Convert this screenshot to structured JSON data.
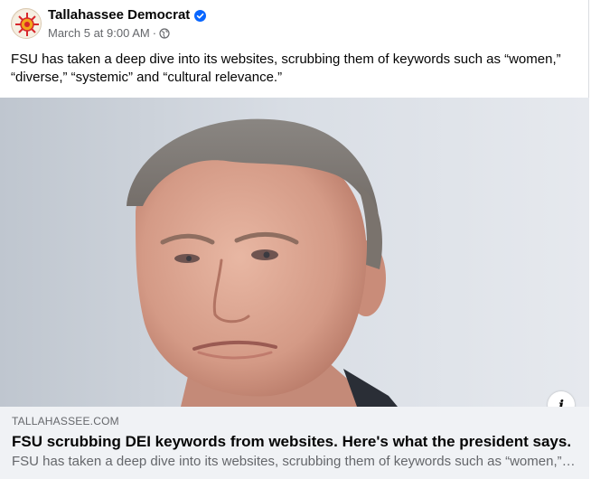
{
  "post": {
    "page_name": "Tallahassee Democrat",
    "verified_icon": "verified-badge-icon",
    "timestamp": "March 5 at 9:00 AM",
    "separator": "·",
    "audience_icon": "globe-icon",
    "caption": "FSU has taken a deep dive into its websites, scrubbing them of keywords such as “women,” “diverse,” “systemic” and “cultural relevance.”"
  },
  "link_preview": {
    "domain": "TALLAHASSEE.COM",
    "headline": "FSU scrubbing DEI keywords from websites. Here's what the president says.",
    "description": "FSU has taken a deep dive into its websites, scrubbing them of keywords such as “women,” “diverse,” “systemic” and “cultural relevance.”",
    "info_label": "i"
  },
  "colors": {
    "verified_blue": "#0866ff",
    "meta_gray": "#65676b",
    "preview_bg": "#f0f2f5"
  }
}
